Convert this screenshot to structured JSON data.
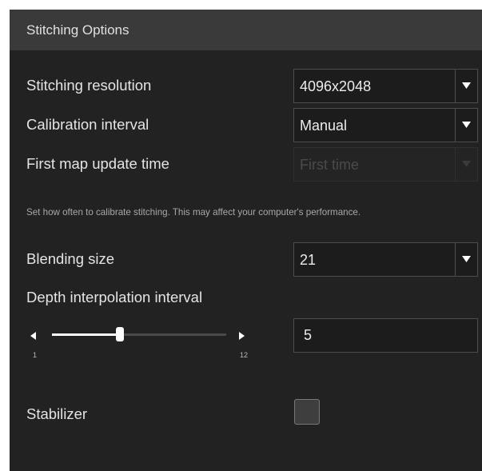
{
  "header": {
    "title": "Stitching Options"
  },
  "options": {
    "stitching_resolution": {
      "label": "Stitching resolution",
      "value": "4096x2048"
    },
    "calibration_interval": {
      "label": "Calibration interval",
      "value": "Manual"
    },
    "first_map_update_time": {
      "label": "First map update time",
      "value": "First time",
      "disabled": true
    },
    "hint": "Set how often to calibrate stitching. This may affect your computer's performance.",
    "blending_size": {
      "label": "Blending size",
      "value": "21"
    },
    "depth_interpolation_interval": {
      "label": "Depth interpolation interval",
      "min": 1,
      "max": 12,
      "min_label": "1",
      "max_label": "12",
      "value": 5,
      "input_value": "5"
    },
    "stabilizer": {
      "label": "Stabilizer",
      "checked": false
    }
  },
  "icons": {
    "dropdown": "chevron-down-icon",
    "slider_left": "caret-left-icon",
    "slider_right": "caret-right-icon"
  },
  "colors": {
    "panel_background": "#222222",
    "header_background": "#3a3a3a",
    "text": "#e4e4e4",
    "disabled_text": "#4b4b4b",
    "slider_fill": "#ffffff"
  }
}
